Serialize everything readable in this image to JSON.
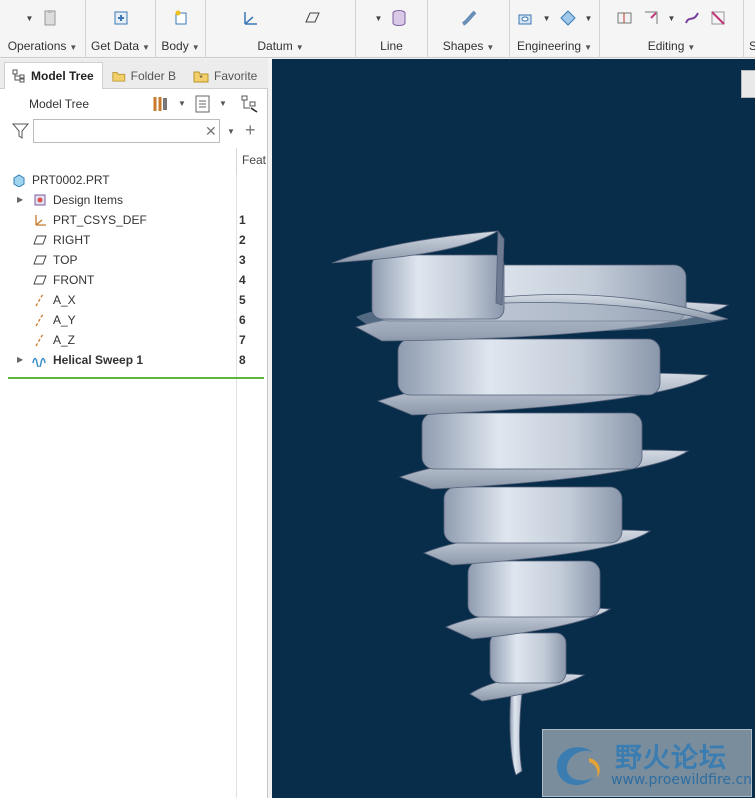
{
  "ribbon": {
    "groups": [
      {
        "label": "Operations",
        "icons": [
          "dropdown-arrow-icon",
          "paste-icon"
        ]
      },
      {
        "label": "Get Data",
        "icons": [
          "import-icon"
        ]
      },
      {
        "label": "Body",
        "icons": [
          "body-icon"
        ]
      },
      {
        "label": "Datum",
        "icons": [
          "csys-icon",
          "plane-icon"
        ]
      },
      {
        "label": "Line",
        "icons": [
          "dropdown-arrow-icon",
          "database-icon"
        ]
      },
      {
        "label": "Shapes",
        "icons": [
          "sweep-icon"
        ]
      },
      {
        "label": "Engineering",
        "icons": [
          "hole-icon",
          "draft-icon"
        ]
      },
      {
        "label": "Editing",
        "icons": [
          "mirror-icon",
          "trim-icon",
          "dropdown-arrow-icon",
          "project-icon",
          "offset-icon"
        ]
      }
    ],
    "cut_label": "S"
  },
  "panel": {
    "tabs": [
      {
        "label": "Model Tree",
        "icon": "model-tree-icon",
        "active": true
      },
      {
        "label": "Folder B",
        "icon": "folder-icon",
        "active": false
      },
      {
        "label": "Favorite",
        "icon": "favorites-icon",
        "active": false
      }
    ],
    "tree_title": "Model Tree",
    "search": {
      "value": "",
      "placeholder": ""
    },
    "column_header": "Feat"
  },
  "tree": {
    "root": {
      "label": "PRT0002.PRT",
      "icon": "part-icon"
    },
    "items": [
      {
        "label": "Design Items",
        "number": "",
        "icon": "design-items-icon",
        "expandable": true
      },
      {
        "label": "PRT_CSYS_DEF",
        "number": "1",
        "icon": "csys-icon",
        "expandable": false
      },
      {
        "label": "RIGHT",
        "number": "2",
        "icon": "datum-plane-icon",
        "expandable": false
      },
      {
        "label": "TOP",
        "number": "3",
        "icon": "datum-plane-icon",
        "expandable": false
      },
      {
        "label": "FRONT",
        "number": "4",
        "icon": "datum-plane-icon",
        "expandable": false
      },
      {
        "label": "A_X",
        "number": "5",
        "icon": "datum-axis-icon",
        "expandable": false
      },
      {
        "label": "A_Y",
        "number": "6",
        "icon": "datum-axis-icon",
        "expandable": false
      },
      {
        "label": "A_Z",
        "number": "7",
        "icon": "datum-axis-icon",
        "expandable": false
      },
      {
        "label": "Helical Sweep 1",
        "number": "8",
        "icon": "helical-sweep-icon",
        "expandable": true
      }
    ]
  },
  "watermark": {
    "title": "野火论坛",
    "url": "www.proewildfire.cn"
  },
  "colors": {
    "viewport_bg": "#082d4a",
    "model_surface": "#c3ccd8",
    "insert_line": "#5fb63e"
  }
}
